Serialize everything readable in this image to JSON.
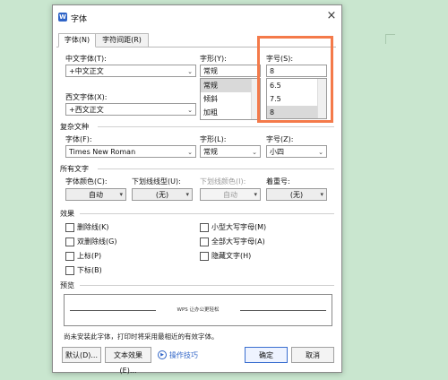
{
  "dialog": {
    "title": "字体",
    "app_icon": "W",
    "close_icon": "×",
    "tabs": [
      "字体(N)",
      "字符间距(R)"
    ]
  },
  "font": {
    "chinese_label": "中文字体(T):",
    "chinese_value": "+中文正文",
    "western_label": "西文字体(X):",
    "western_value": "+西文正文",
    "style_label": "字形(Y):",
    "style_value": "常规",
    "style_options": [
      "常规",
      "倾斜",
      "加粗"
    ],
    "size_label": "字号(S):",
    "size_value": "8",
    "size_options": [
      "6.5",
      "7.5",
      "8"
    ],
    "size_selected": "8"
  },
  "complex": {
    "section": "复杂文种",
    "font_label": "字体(F):",
    "font_value": "Times New Roman",
    "style_label": "字形(L):",
    "style_value": "常规",
    "size_label": "字号(Z):",
    "size_value": "小四"
  },
  "all_text": {
    "section": "所有文字",
    "color_label": "字体颜色(C):",
    "color_value": "自动",
    "underline_label": "下划线线型(U):",
    "underline_value": "(无)",
    "underline_color_label": "下划线颜色(I):",
    "underline_color_value": "自动",
    "emphasis_label": "着重号:",
    "emphasis_value": "(无)"
  },
  "effects": {
    "section": "效果",
    "left": [
      "删除线(K)",
      "双删除线(G)",
      "上标(P)",
      "下标(B)"
    ],
    "right": [
      "小型大写字母(M)",
      "全部大写字母(A)",
      "隐藏文字(H)"
    ]
  },
  "preview": {
    "section": "预览",
    "sample": "WPS 让办公更轻松"
  },
  "hint": "尚未安装此字体，打印时将采用最相近的有效字体。",
  "footer": {
    "default": "默认(D)...",
    "text_effects": "文本效果(E)...",
    "tips": "操作技巧",
    "ok": "确定",
    "cancel": "取消"
  },
  "colors": {
    "accent": "#2f64c7",
    "highlight": "#f47a4a",
    "background": "#c9e6cf"
  }
}
